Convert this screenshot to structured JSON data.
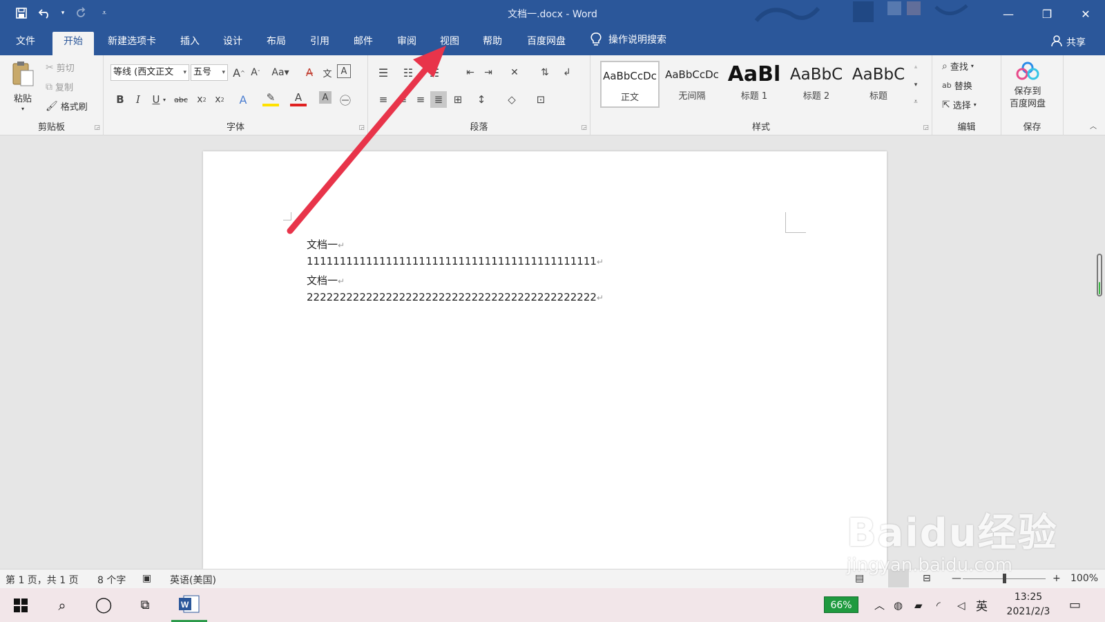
{
  "window": {
    "title": "文档一.docx  -  Word",
    "minimize": "—",
    "restore": "❐",
    "close": "✕"
  },
  "qat": {
    "save": "save-icon",
    "undo": "undo-icon",
    "redo": "redo-icon",
    "customize": "customize-icon"
  },
  "tabs": [
    {
      "label": "文件",
      "active": false
    },
    {
      "label": "开始",
      "active": true
    },
    {
      "label": "新建选项卡",
      "active": false
    },
    {
      "label": "插入",
      "active": false
    },
    {
      "label": "设计",
      "active": false
    },
    {
      "label": "布局",
      "active": false
    },
    {
      "label": "引用",
      "active": false
    },
    {
      "label": "邮件",
      "active": false
    },
    {
      "label": "审阅",
      "active": false
    },
    {
      "label": "视图",
      "active": false
    },
    {
      "label": "帮助",
      "active": false
    },
    {
      "label": "百度网盘",
      "active": false
    }
  ],
  "tellme": {
    "label": "操作说明搜索"
  },
  "share": {
    "label": "共享"
  },
  "clipboard": {
    "paste": "粘贴",
    "cut": "剪切",
    "copy": "复制",
    "format_painter": "格式刷",
    "group": "剪贴板"
  },
  "font": {
    "name": "等线 (西文正文",
    "size": "五号",
    "group": "字体"
  },
  "paragraph": {
    "group": "段落"
  },
  "styles": {
    "group": "样式",
    "items": [
      {
        "preview": "AaBbCcDc",
        "name": "正文",
        "selected": true
      },
      {
        "preview": "AaBbCcDc",
        "name": "无间隔",
        "selected": false
      },
      {
        "preview": "AaBl",
        "name": "标题 1",
        "selected": false
      },
      {
        "preview": "AaBbC",
        "name": "标题 2",
        "selected": false
      },
      {
        "preview": "AaBbC",
        "name": "标题",
        "selected": false
      }
    ]
  },
  "editing": {
    "find": "查找",
    "replace": "替换",
    "select": "选择",
    "group": "编辑"
  },
  "save": {
    "label_line1": "保存到",
    "label_line2": "百度网盘",
    "group": "保存"
  },
  "document": {
    "lines": [
      "文档一",
      "11111111111111111111111111111111111111111111",
      "文档一",
      "22222222222222222222222222222222222222222222"
    ],
    "para_mark": "↵"
  },
  "statusbar": {
    "page": "第 1 页，共 1 页",
    "words": "8 个字",
    "language": "英语(美国)",
    "zoom": "100%"
  },
  "taskbar": {
    "battery": "66%",
    "ime": "英",
    "time": "13:25",
    "date": "2021/2/3"
  },
  "watermark": {
    "brand": "Baidu经验",
    "url": "jingyan.baidu.com"
  },
  "colors": {
    "ribbon_blue": "#2b579a",
    "arrow": "#e8344a",
    "battery": "#1f9a3f"
  }
}
